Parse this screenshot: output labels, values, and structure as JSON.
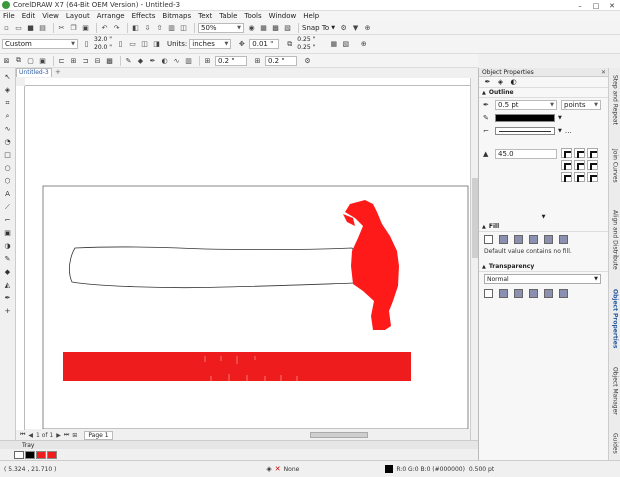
{
  "window": {
    "title": "CorelDRAW X7 (64-Bit OEM Version) - Untitled-3",
    "min": "–",
    "max": "□",
    "close": "✕"
  },
  "menu": [
    "File",
    "Edit",
    "View",
    "Layout",
    "Arrange",
    "Effects",
    "Bitmaps",
    "Text",
    "Table",
    "Tools",
    "Window",
    "Help"
  ],
  "toolbar": {
    "zoom": "50%",
    "snap_to": "Snap To"
  },
  "property_bar": {
    "preset": "Custom",
    "width": "32.0 \"",
    "height": "20.0 \"",
    "units_label": "Units:",
    "units": "inches",
    "nudge": "0.01 \"",
    "dup_x": "0.25 \"",
    "dup_y": "0.25 \""
  },
  "toolbar3": {
    "field1": "0.2 \"",
    "field2": "0.2 \""
  },
  "document": {
    "tab": "Untitled-3",
    "page_count": "1 of 1",
    "page_tab": "Page 1"
  },
  "tray": {
    "label": "Tray"
  },
  "status": {
    "coords": "( 5.324 , 21.710 )",
    "fill_label": "None",
    "color_info": "R:0 G:0 B:0 (#000000)",
    "outline_width": "0.500 pt"
  },
  "panel": {
    "title": "Object Properties",
    "outline": {
      "title": "Outline",
      "width": "0.5 pt",
      "units": "points",
      "miter": "45.0"
    },
    "fill": {
      "title": "Fill",
      "note": "Default value contains no fill."
    },
    "transparency": {
      "title": "Transparency",
      "mode": "Normal"
    }
  },
  "docker_tabs": [
    "Step and Repeat",
    "Join Curves",
    "Align and Distribute",
    "Object Properties",
    "Object Manager",
    "Guides"
  ],
  "colors": {
    "hammer_red": "#ff1a1a",
    "accent_blue": "#2a5aa0",
    "bar_red": "#ee1c1c"
  }
}
